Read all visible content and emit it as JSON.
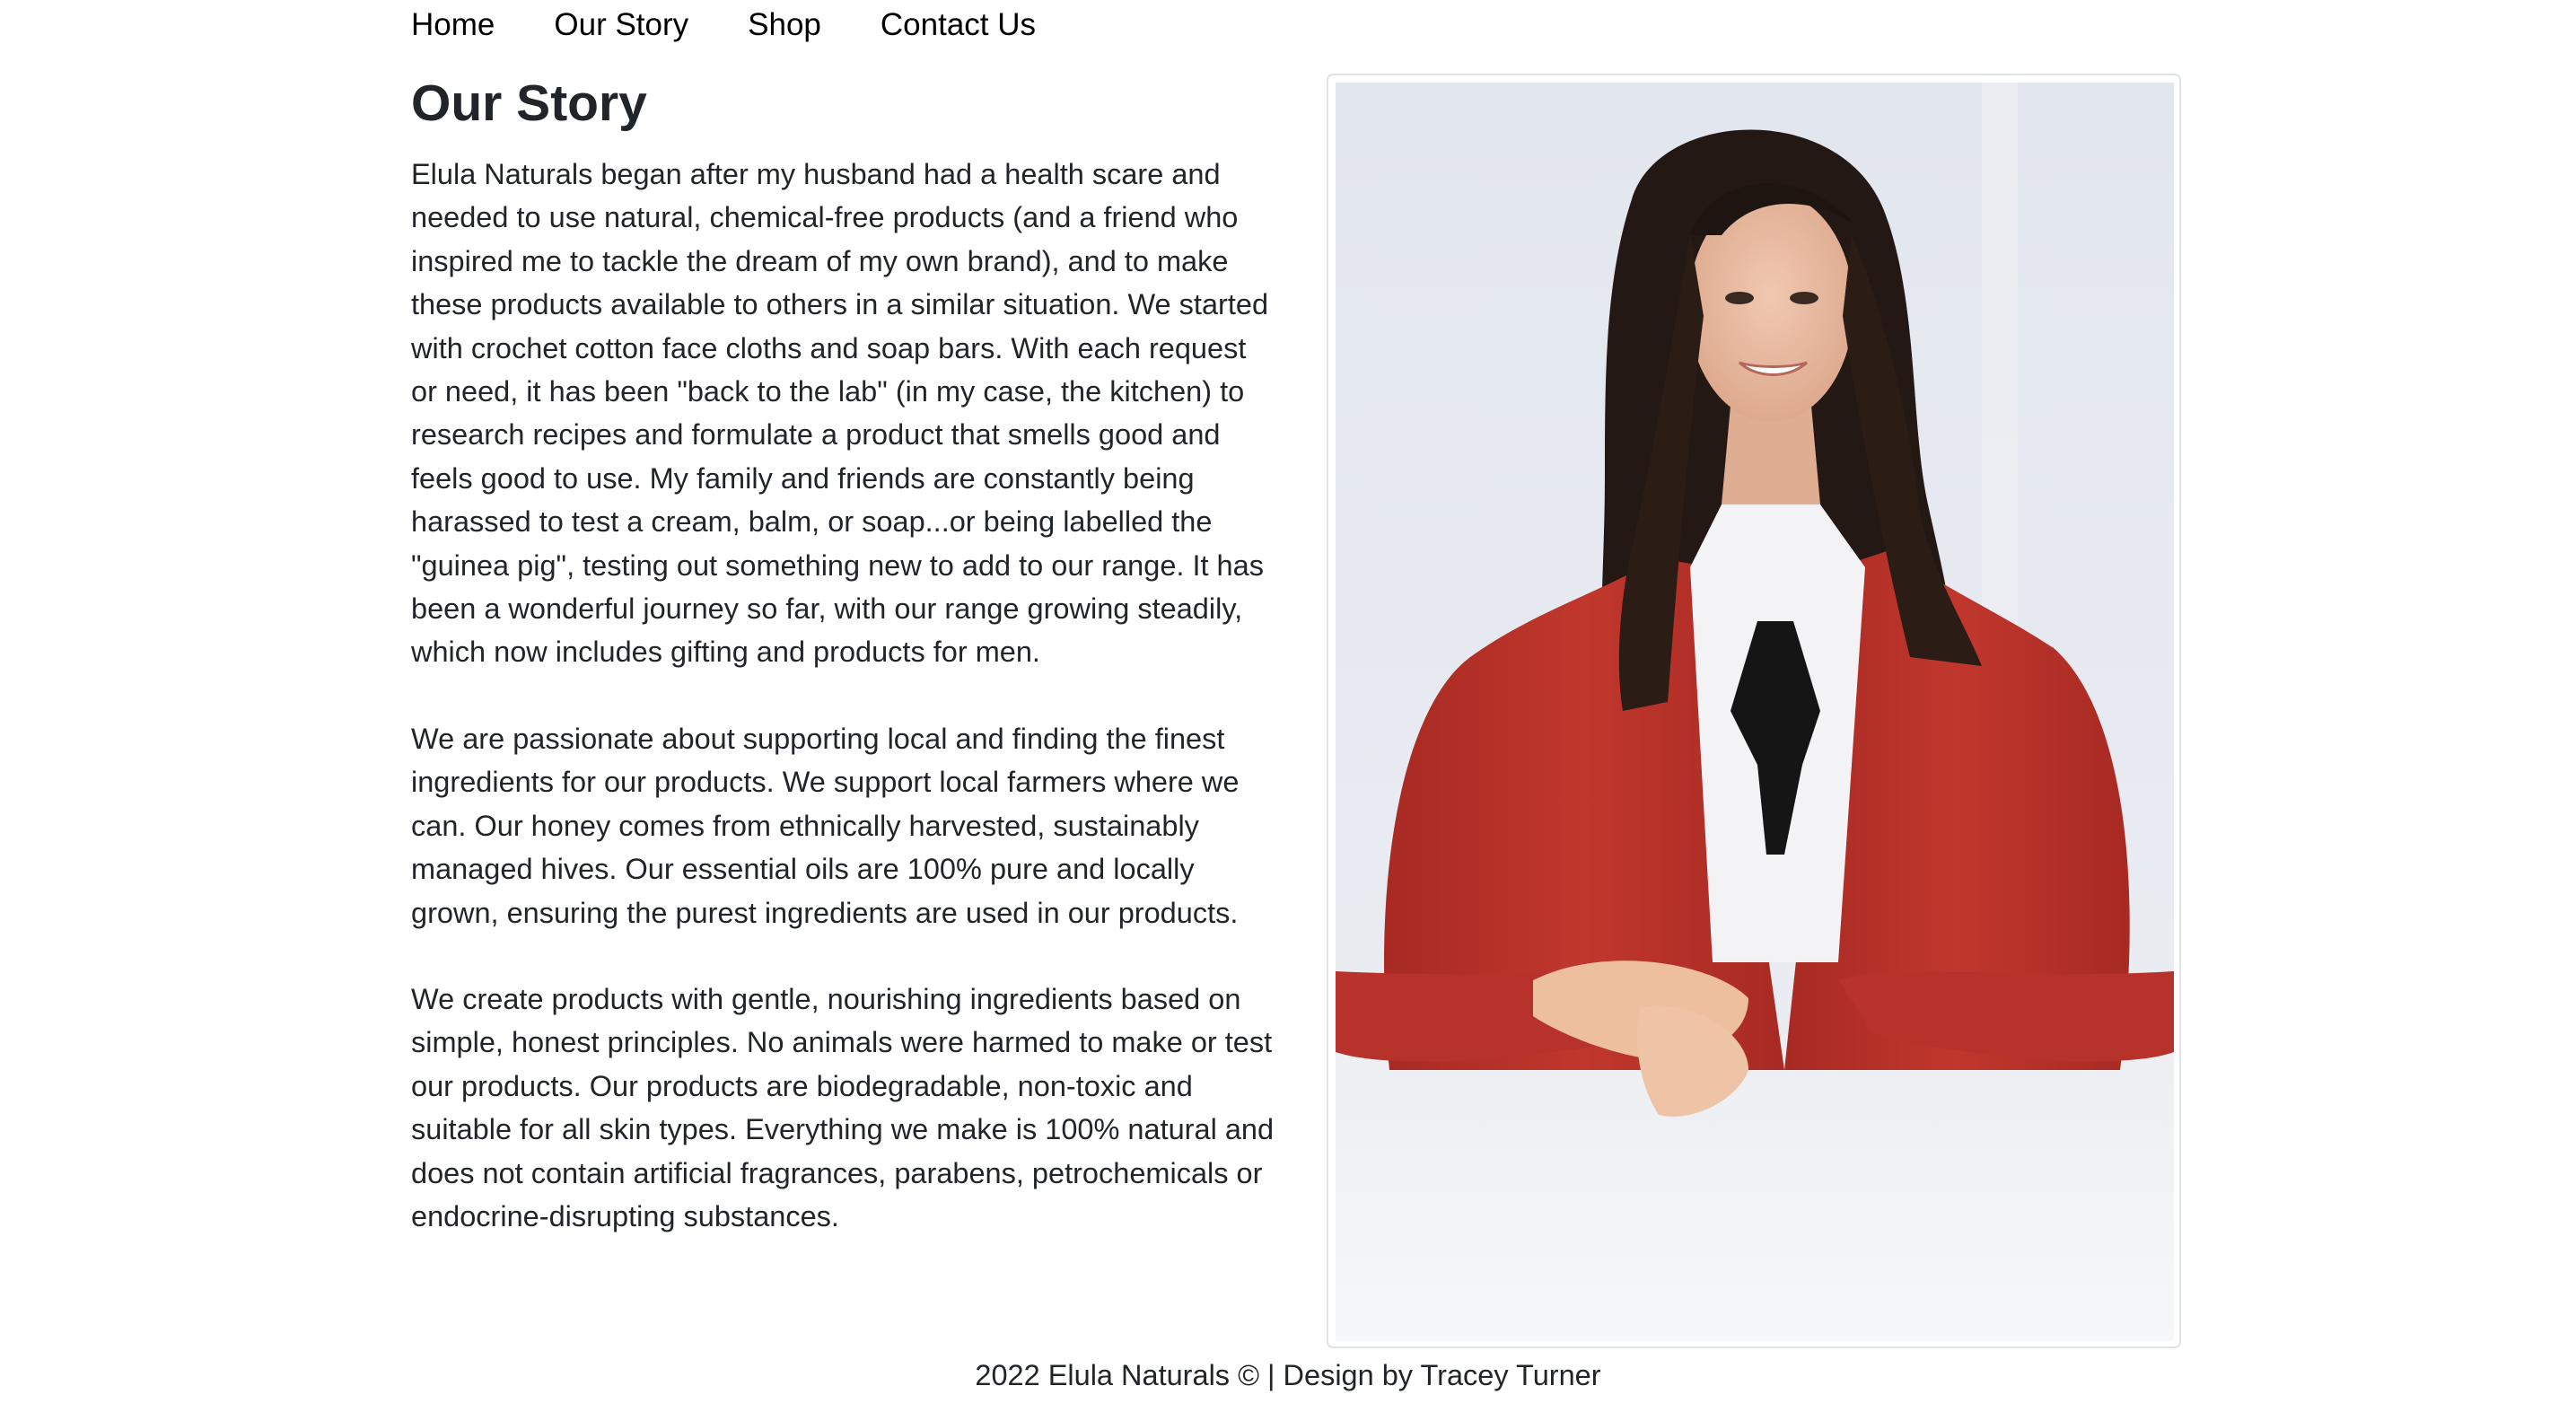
{
  "nav": {
    "items": [
      {
        "label": "Home"
      },
      {
        "label": "Our Story"
      },
      {
        "label": "Shop"
      },
      {
        "label": "Contact Us"
      }
    ]
  },
  "story": {
    "title": "Our Story",
    "paragraphs": [
      "Elula Naturals began after my husband had a health scare and needed to use natural, chemical-free products (and a friend who inspired me to tackle the dream of my own brand), and to make these products available to others in a similar situation. We started with crochet cotton face cloths and soap bars. With each request or need, it has been \"back to the lab\" (in my case, the kitchen) to research recipes and formulate a product that smells good and feels good to use. My family and friends are constantly being harassed to test a cream, balm, or soap...or being labelled the \"guinea pig\", testing out something new to add to our range. It has been a wonderful journey so far, with our range growing steadily, which now includes gifting and products for men.",
      "We are passionate about supporting local and finding the finest ingredients for our products. We support local farmers where we can. Our honey comes from ethnically harvested, sustainably managed hives. Our essential oils are 100% pure and locally grown, ensuring the purest ingredients are used in our products.",
      "We create products with gentle, nourishing ingredients based on simple, honest principles. No animals were harmed to make or test our products. Our products are biodegradable, non-toxic and suitable for all skin types. Everything we make is 100% natural and does not contain artificial fragrances, parabens, petrochemicals or endocrine-disrupting substances."
    ]
  },
  "photo": {
    "icon": "founder-portrait-photo",
    "colors": {
      "jacket": "#b8322a",
      "hair": "#2a1c17",
      "skin": "#e9bfa5",
      "blouse": "#f4f4f6",
      "background": "#e6e9ef"
    }
  },
  "footer": {
    "text": "2022 Elula Naturals © | Design by Tracey Turner"
  }
}
